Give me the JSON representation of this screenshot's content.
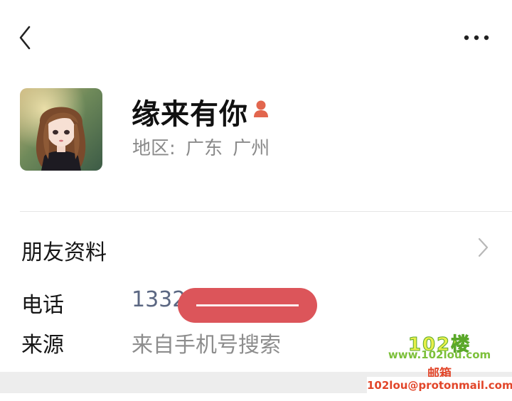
{
  "header": {
    "back_icon": "chevron-left-icon",
    "more_icon": "more-horizontal-icon"
  },
  "profile": {
    "name": "缘来有你",
    "gender_icon": "female-icon",
    "gender_color": "#e2664e",
    "region": "地区: 广东 广州"
  },
  "friend_info": {
    "label": "朋友资料",
    "chevron_icon": "chevron-right-icon"
  },
  "details": {
    "phone_label": "电话",
    "phone_value": "1332",
    "source_label": "来源",
    "source_value": "来自手机号搜索"
  },
  "redaction_color": "#dc555a",
  "watermark": {
    "logo": "102楼",
    "site": "www.102lou.com",
    "mail_label": "邮箱",
    "email": "102lou@protonmail.com"
  }
}
